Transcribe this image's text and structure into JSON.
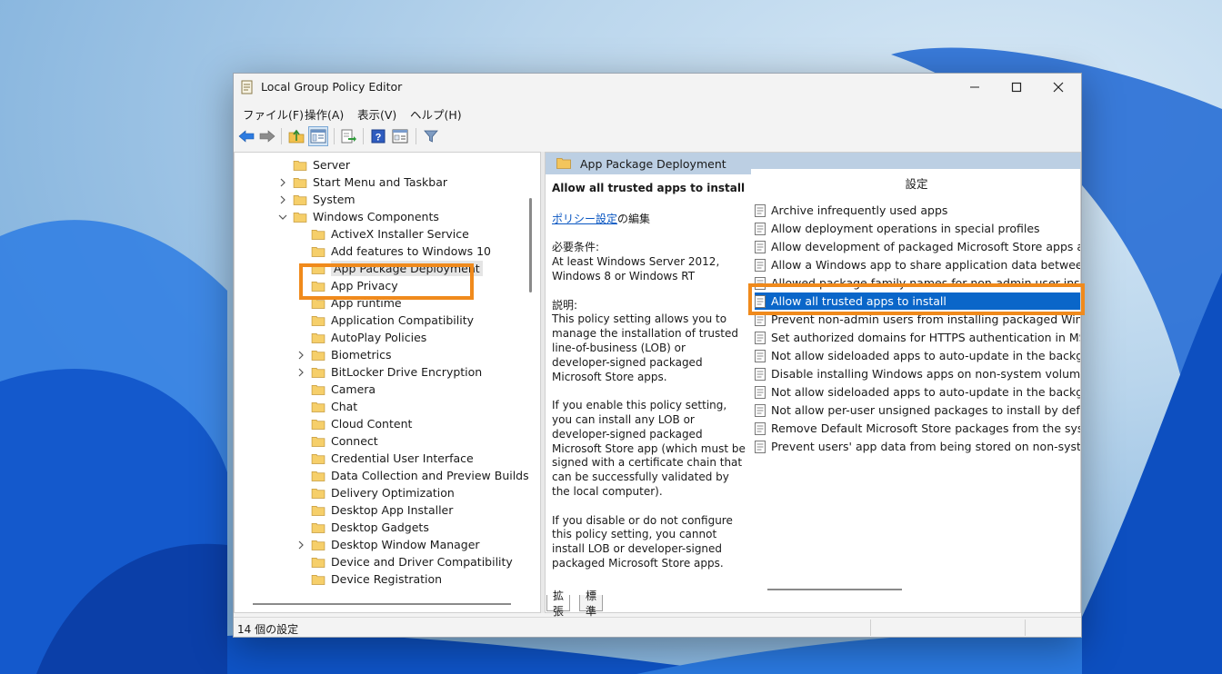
{
  "window": {
    "title": "Local Group Policy Editor",
    "controls": [
      "minimize",
      "maximize",
      "close"
    ]
  },
  "menubar": {
    "items": [
      "ファイル(F)",
      "操作(A)",
      "表示(V)",
      "ヘルプ(H)"
    ]
  },
  "toolbar": {
    "icons": [
      "back-arrow-icon",
      "forward-arrow-icon",
      "up-folder-icon",
      "show-hide-tree-icon",
      "export-list-icon",
      "help-icon",
      "properties-view-icon",
      "filter-icon"
    ]
  },
  "tree": {
    "items": [
      {
        "label": "Server",
        "expander": "none"
      },
      {
        "label": "Start Menu and Taskbar",
        "expander": "collapsed"
      },
      {
        "label": "System",
        "expander": "collapsed"
      },
      {
        "label": "Windows Components",
        "expander": "expanded"
      },
      {
        "label": "ActiveX Installer Service",
        "expander": "none"
      },
      {
        "label": "Add features to Windows 10",
        "expander": "none"
      },
      {
        "label": "App Package Deployment",
        "expander": "none",
        "selected": true
      },
      {
        "label": "App Privacy",
        "expander": "none"
      },
      {
        "label": "App runtime",
        "expander": "none"
      },
      {
        "label": "Application Compatibility",
        "expander": "none"
      },
      {
        "label": "AutoPlay Policies",
        "expander": "none"
      },
      {
        "label": "Biometrics",
        "expander": "collapsed"
      },
      {
        "label": "BitLocker Drive Encryption",
        "expander": "collapsed"
      },
      {
        "label": "Camera",
        "expander": "none"
      },
      {
        "label": "Chat",
        "expander": "none"
      },
      {
        "label": "Cloud Content",
        "expander": "none"
      },
      {
        "label": "Connect",
        "expander": "none"
      },
      {
        "label": "Credential User Interface",
        "expander": "none"
      },
      {
        "label": "Data Collection and Preview Builds",
        "expander": "none"
      },
      {
        "label": "Delivery Optimization",
        "expander": "none"
      },
      {
        "label": "Desktop App Installer",
        "expander": "none"
      },
      {
        "label": "Desktop Gadgets",
        "expander": "none"
      },
      {
        "label": "Desktop Window Manager",
        "expander": "collapsed"
      },
      {
        "label": "Device and Driver Compatibility",
        "expander": "none"
      },
      {
        "label": "Device Registration",
        "expander": "none"
      }
    ]
  },
  "details": {
    "header": "App Package Deployment",
    "policy_title": "Allow all trusted apps to install",
    "edit_link": "ポリシー設定",
    "edit_suffix": "の編集",
    "requirements_label": "必要条件:",
    "requirements": "At least Windows Server 2012, Windows 8 or Windows RT",
    "description_label": "説明:",
    "description": [
      "This policy setting allows you to manage the installation of trusted line-of-business (LOB) or developer-signed packaged Microsoft Store apps.",
      "If you enable this policy setting, you can install any LOB or developer-signed packaged Microsoft Store app (which must be signed with a certificate chain that can be successfully validated by the local computer).",
      "If you disable or do not configure this policy setting, you cannot install LOB or developer-signed packaged Microsoft Store apps."
    ]
  },
  "settings": {
    "column_header": "設定",
    "items": [
      {
        "label": "Archive infrequently used apps"
      },
      {
        "label": "Allow deployment operations in special profiles"
      },
      {
        "label": "Allow development of packaged Microsoft Store apps and i..."
      },
      {
        "label": "Allow a Windows app to share application data between users"
      },
      {
        "label": "Allowed package family names for non-admin user install"
      },
      {
        "label": "Allow all trusted apps to install",
        "selected": true
      },
      {
        "label": "Prevent non-admin users from installing packaged Windows..."
      },
      {
        "label": "Set authorized domains for HTTPS authentication in MSIX str..."
      },
      {
        "label": "Not allow sideloaded apps to auto-update in the background"
      },
      {
        "label": "Disable installing Windows apps on non-system volumes"
      },
      {
        "label": "Not allow sideloaded apps to auto-update in the backgroun..."
      },
      {
        "label": "Not allow per-user unsigned packages to install by default (r..."
      },
      {
        "label": "Remove Default Microsoft Store packages from the system."
      },
      {
        "label": "Prevent users' app data from being stored on non-system vo..."
      }
    ]
  },
  "tabs": [
    "拡張",
    "標準"
  ],
  "statusbar": {
    "text": "14 個の設定"
  },
  "colors": {
    "highlight": "#f08a1c",
    "selection": "#0a66c9",
    "header": "#bccfe3",
    "link": "#0a57c2"
  }
}
